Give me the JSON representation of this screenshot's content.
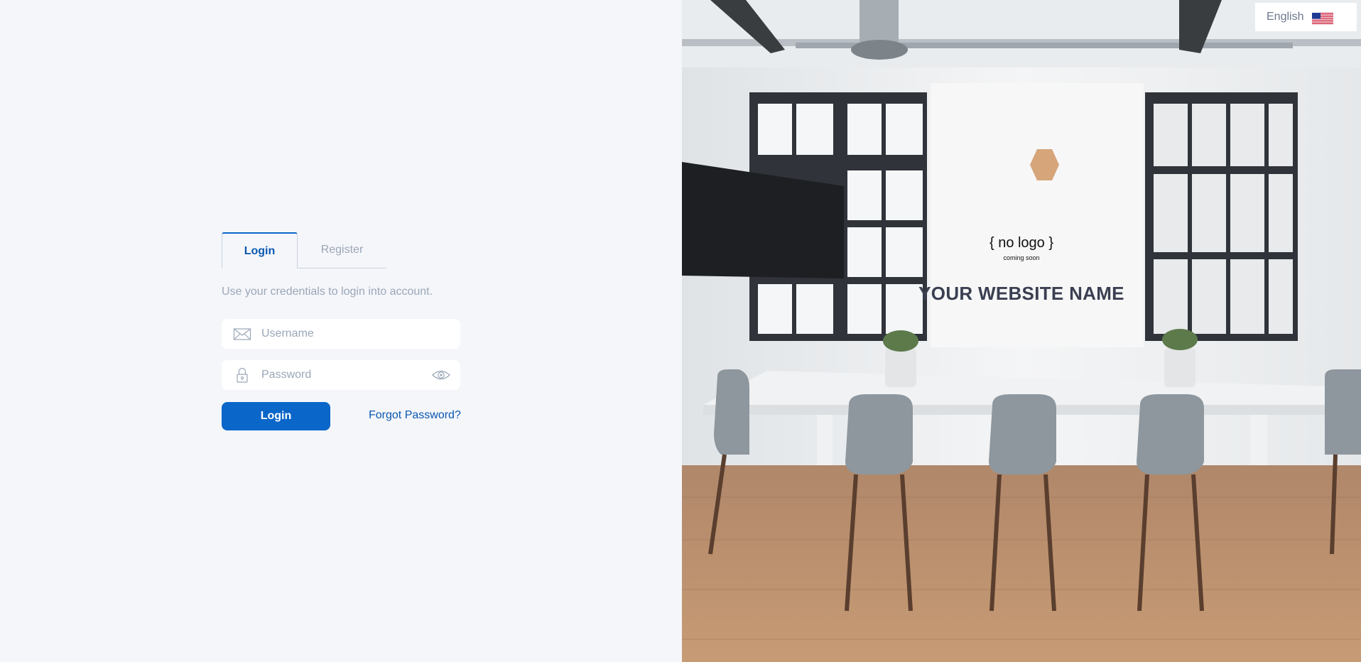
{
  "tabs": {
    "login_label": "Login",
    "register_label": "Register"
  },
  "subtitle": "Use your credentials to login into account.",
  "form": {
    "username_placeholder": "Username",
    "username_value": "",
    "password_placeholder": "Password",
    "password_value": "",
    "login_button": "Login",
    "forgot_link": "Forgot Password?"
  },
  "brand": {
    "logo_text": "{ no logo }",
    "logo_subtext": "coming soon",
    "website_name": "YOUR WEBSITE NAME"
  },
  "language": {
    "selected": "English",
    "flag_icon": "us-flag-icon"
  },
  "colors": {
    "accent": "#0a66c9",
    "background": "#f5f6fa",
    "muted_text": "#9aa7b7"
  },
  "icons": {
    "username": "envelope-icon",
    "password": "lock-icon",
    "toggle_password": "eye-icon"
  }
}
